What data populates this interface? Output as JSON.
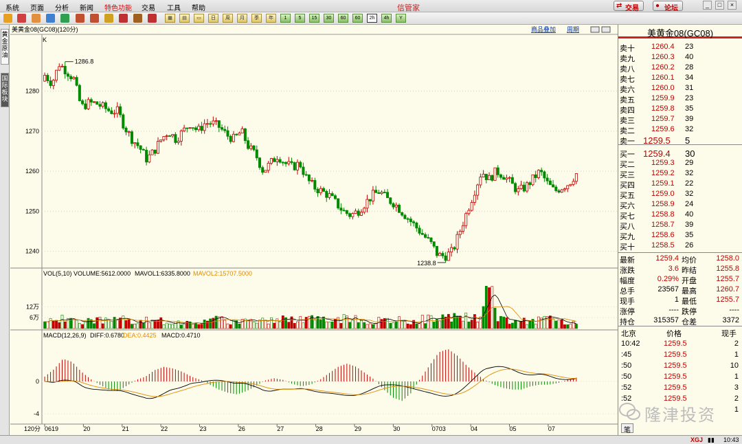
{
  "menu": {
    "items": [
      "系统",
      "页面",
      "分析",
      "新闻",
      "特色功能",
      "交易",
      "工具",
      "帮助"
    ],
    "highlight_index": 4,
    "app_title": "信管家",
    "trade_button": "交易",
    "forum_button": "论坛"
  },
  "toolbar": {
    "period_buttons": [
      "1",
      "5",
      "15",
      "30",
      "60",
      "2h",
      "4h",
      "Y"
    ],
    "active_period": "2h"
  },
  "left_tabs": [
    "黄金原油",
    "国际板块"
  ],
  "chart": {
    "header_text": "美黄金08(GC08)(120分)",
    "link_overlay": "商品叠加",
    "link_cycle": "周期",
    "k_label": "K",
    "high_label": "1286.8",
    "low_label": "1238.8",
    "vol_legend": {
      "title": "VOL(5,10) VOLUME:5612.0000",
      "mavol1": "MAVOL1:6335.8000",
      "mavol2": "MAVOL2:15707.5000"
    },
    "macd_legend": {
      "title": "MACD(12,26,9)",
      "diff": "DIFF:0.6780",
      "dea": "DEA:0.4425",
      "macd": "MACD:0.4710"
    },
    "period_label": "120分"
  },
  "chart_data": {
    "type": "candlestick",
    "y_ticks": [
      1240,
      1250,
      1260,
      1270,
      1280
    ],
    "ylim": [
      1236.5,
      1293.5
    ],
    "vol_ticks": [
      "6万",
      "12万"
    ],
    "macd_ticks": [
      "0",
      "-4"
    ],
    "x_labels": [
      "0619",
      "20",
      "21",
      "22",
      "23",
      "26",
      "27",
      "28",
      "29",
      "30",
      "0703",
      "04",
      "05",
      "07"
    ],
    "close_path": [
      1284,
      1282,
      1286.8,
      1285,
      1283,
      1276,
      1277,
      1277,
      1276,
      1275,
      1275,
      1271,
      1268,
      1266,
      1263,
      1265,
      1268,
      1270,
      1268,
      1270,
      1272,
      1270,
      1272,
      1272,
      1271,
      1269,
      1268,
      1270,
      1266,
      1264,
      1260,
      1262,
      1264,
      1262,
      1261,
      1262,
      1258,
      1256,
      1255,
      1254,
      1252,
      1250,
      1249,
      1250,
      1252,
      1254,
      1255,
      1253,
      1252,
      1250,
      1248,
      1246,
      1244,
      1242,
      1239,
      1238.8,
      1240,
      1245,
      1250,
      1255,
      1260,
      1258,
      1260,
      1259,
      1257,
      1255,
      1256,
      1258,
      1260,
      1257,
      1255,
      1256,
      1257,
      1259.4
    ],
    "volume_path": [
      10,
      8,
      14,
      9,
      11,
      7,
      9,
      12,
      8,
      10,
      9,
      11,
      8,
      7,
      10,
      8,
      9,
      8,
      9,
      7,
      10,
      9,
      8,
      11,
      10,
      9,
      8,
      10,
      12,
      11,
      9,
      10,
      14,
      12,
      10,
      11,
      13,
      12,
      11,
      9,
      10,
      12,
      10,
      11,
      9,
      8,
      10,
      9,
      11,
      10,
      9,
      10,
      12,
      13,
      11,
      14,
      12,
      15,
      14,
      13,
      12,
      50,
      15,
      12,
      10,
      11,
      10,
      9,
      10,
      11,
      10,
      9,
      8,
      5.6
    ],
    "macd_bar_path": [
      0.6,
      1.5,
      2.8,
      2.4,
      1.2,
      0.3,
      -0.4,
      -1,
      -1.2,
      -0.5,
      0.2,
      0.6,
      1.4,
      1.8,
      1.6,
      1.2,
      0.6,
      0.2,
      -0.4,
      -1,
      -1.4,
      -1.6,
      -1.2,
      -0.6,
      0.1,
      0.4,
      0.2,
      -0.3,
      -0.6,
      -0.4,
      0.2,
      1,
      1.8,
      2.2,
      1.8,
      1,
      0.2,
      -1,
      -2,
      -2.4,
      -1.4,
      0.4,
      2,
      3.6,
      4,
      3.2,
      2,
      1,
      0.2,
      -0.4,
      -0.8,
      -1,
      -1,
      -0.6,
      -0.4,
      -0.4,
      -0.2,
      0.2,
      0.47
    ]
  },
  "panel": {
    "title": "美黄金08(GC08)",
    "asks": [
      {
        "label": "卖十",
        "price": "1260.4",
        "vol": "23"
      },
      {
        "label": "卖九",
        "price": "1260.3",
        "vol": "40"
      },
      {
        "label": "卖八",
        "price": "1260.2",
        "vol": "28"
      },
      {
        "label": "卖七",
        "price": "1260.1",
        "vol": "34"
      },
      {
        "label": "卖六",
        "price": "1260.0",
        "vol": "31"
      },
      {
        "label": "卖五",
        "price": "1259.9",
        "vol": "23"
      },
      {
        "label": "卖四",
        "price": "1259.8",
        "vol": "35"
      },
      {
        "label": "卖三",
        "price": "1259.7",
        "vol": "39"
      },
      {
        "label": "卖二",
        "price": "1259.6",
        "vol": "32"
      },
      {
        "label": "卖一",
        "price": "1259.5",
        "vol": "5"
      }
    ],
    "bids": [
      {
        "label": "买一",
        "price": "1259.4",
        "vol": "30"
      },
      {
        "label": "买二",
        "price": "1259.3",
        "vol": "29"
      },
      {
        "label": "买三",
        "price": "1259.2",
        "vol": "32"
      },
      {
        "label": "买四",
        "price": "1259.1",
        "vol": "22"
      },
      {
        "label": "买五",
        "price": "1259.0",
        "vol": "32"
      },
      {
        "label": "买六",
        "price": "1258.9",
        "vol": "24"
      },
      {
        "label": "买七",
        "price": "1258.8",
        "vol": "40"
      },
      {
        "label": "买八",
        "price": "1258.7",
        "vol": "39"
      },
      {
        "label": "买九",
        "price": "1258.6",
        "vol": "35"
      },
      {
        "label": "买十",
        "price": "1258.5",
        "vol": "26"
      }
    ],
    "stats": [
      {
        "l1": "最新",
        "v1": "1259.4",
        "l2": "均价",
        "v2": "1258.0"
      },
      {
        "l1": "涨跌",
        "v1": "3.6",
        "l2": "昨结",
        "v2": "1255.8"
      },
      {
        "l1": "幅度",
        "v1": "0.29%",
        "l2": "开盘",
        "v2": "1255.7"
      },
      {
        "l1": "总手",
        "v1": "23567",
        "l2": "最高",
        "v2": "1260.7"
      },
      {
        "l1": "现手",
        "v1": "1",
        "l2": "最低",
        "v2": "1255.7"
      },
      {
        "l1": "涨停",
        "v1": "----",
        "l2": "跌停",
        "v2": "----"
      },
      {
        "l1": "持仓",
        "v1": "315357",
        "l2": "仓差",
        "v2": "3372"
      }
    ],
    "ticks_header": {
      "location": "北京",
      "price": "价格",
      "vol": "现手"
    },
    "ticks": [
      {
        "time": "10:42",
        "price": "1259.5",
        "vol": "2"
      },
      {
        "time": ":45",
        "price": "1259.5",
        "vol": "1"
      },
      {
        "time": ":50",
        "price": "1259.5",
        "vol": "10"
      },
      {
        "time": ":50",
        "price": "1259.5",
        "vol": "1"
      },
      {
        "time": ":52",
        "price": "1259.5",
        "vol": "3"
      },
      {
        "time": ":52",
        "price": "1259.5",
        "vol": "2"
      },
      {
        "time": "",
        "price": "",
        "vol": "1"
      }
    ],
    "bottom_tab": "笔"
  },
  "watermark": "隆津投资",
  "status": {
    "brand": "XGJ",
    "time": "10:43"
  },
  "colors": {
    "up": "#c00000",
    "down": "#008a00",
    "diff": "#000000",
    "dea": "#e08a00",
    "mavol": "#000000"
  }
}
